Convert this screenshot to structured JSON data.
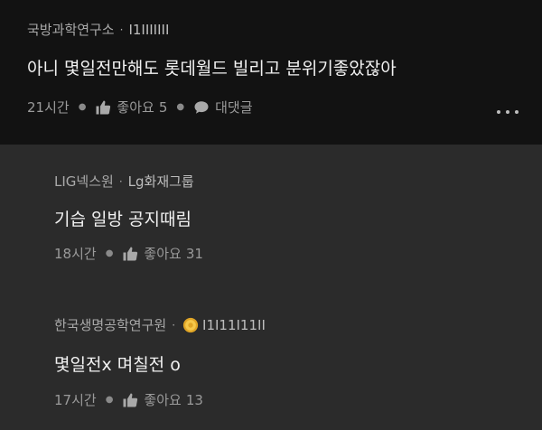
{
  "post": {
    "author": "국방과학연구소",
    "flair": "I1IIIIIII",
    "text": "아니 몇일전만해도 롯데월드 빌리고 분위기좋았잖아",
    "time": "21시간",
    "like_label": "좋아요",
    "like_count": "5",
    "reply_label": "대댓글"
  },
  "replies": [
    {
      "author": "LIG넥스원",
      "flair": "Lg화재그룹",
      "text": "기습 일방 공지때림",
      "time": "18시간",
      "like_label": "좋아요",
      "like_count": "31"
    },
    {
      "author": "한국생명공학연구원",
      "flair": "I1I11I11II",
      "text": "몇일전x 며칠전 o",
      "time": "17시간",
      "like_label": "좋아요",
      "like_count": "13"
    }
  ],
  "icons": {
    "like": "thumbs-up-icon",
    "reply": "speech-bubble-icon",
    "more": "more-horizontal-icon",
    "badge": "gold-coin-icon"
  },
  "colors": {
    "post_bg": "#121212",
    "reply_bg": "#2b2b2b",
    "text": "#f2f2f2",
    "muted": "#9a9a9a"
  }
}
